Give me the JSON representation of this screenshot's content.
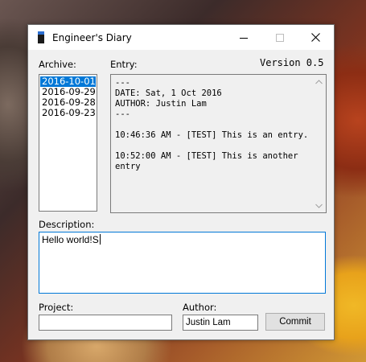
{
  "window": {
    "title": "Engineer's Diary",
    "version": "Version 0.5"
  },
  "archive": {
    "label": "Archive:",
    "items": [
      "2016-10-01",
      "2016-09-29",
      "2016-09-28",
      "2016-09-23"
    ],
    "selected_index": 0
  },
  "entry": {
    "label": "Entry:",
    "text": "---\nDATE: Sat, 1 Oct 2016\nAUTHOR: Justin Lam\n---\n\n10:46:36 AM - [TEST] This is an entry.\n\n10:52:00 AM - [TEST] This is another entry"
  },
  "description": {
    "label": "Description:",
    "value": "Hello world!S"
  },
  "project": {
    "label": "Project:",
    "value": ""
  },
  "author": {
    "label": "Author:",
    "value": "Justin Lam"
  },
  "commit": {
    "label": "Commit"
  },
  "icons": {
    "app": "diary-book-icon",
    "minimize": "minimize-icon",
    "maximize": "maximize-icon",
    "close": "close-icon",
    "scroll_up": "chevron-up-icon",
    "scroll_down": "chevron-down-icon"
  },
  "colors": {
    "selection": "#0078d7",
    "focus_border": "#0078d7",
    "window_bg": "#f0f0f0"
  }
}
